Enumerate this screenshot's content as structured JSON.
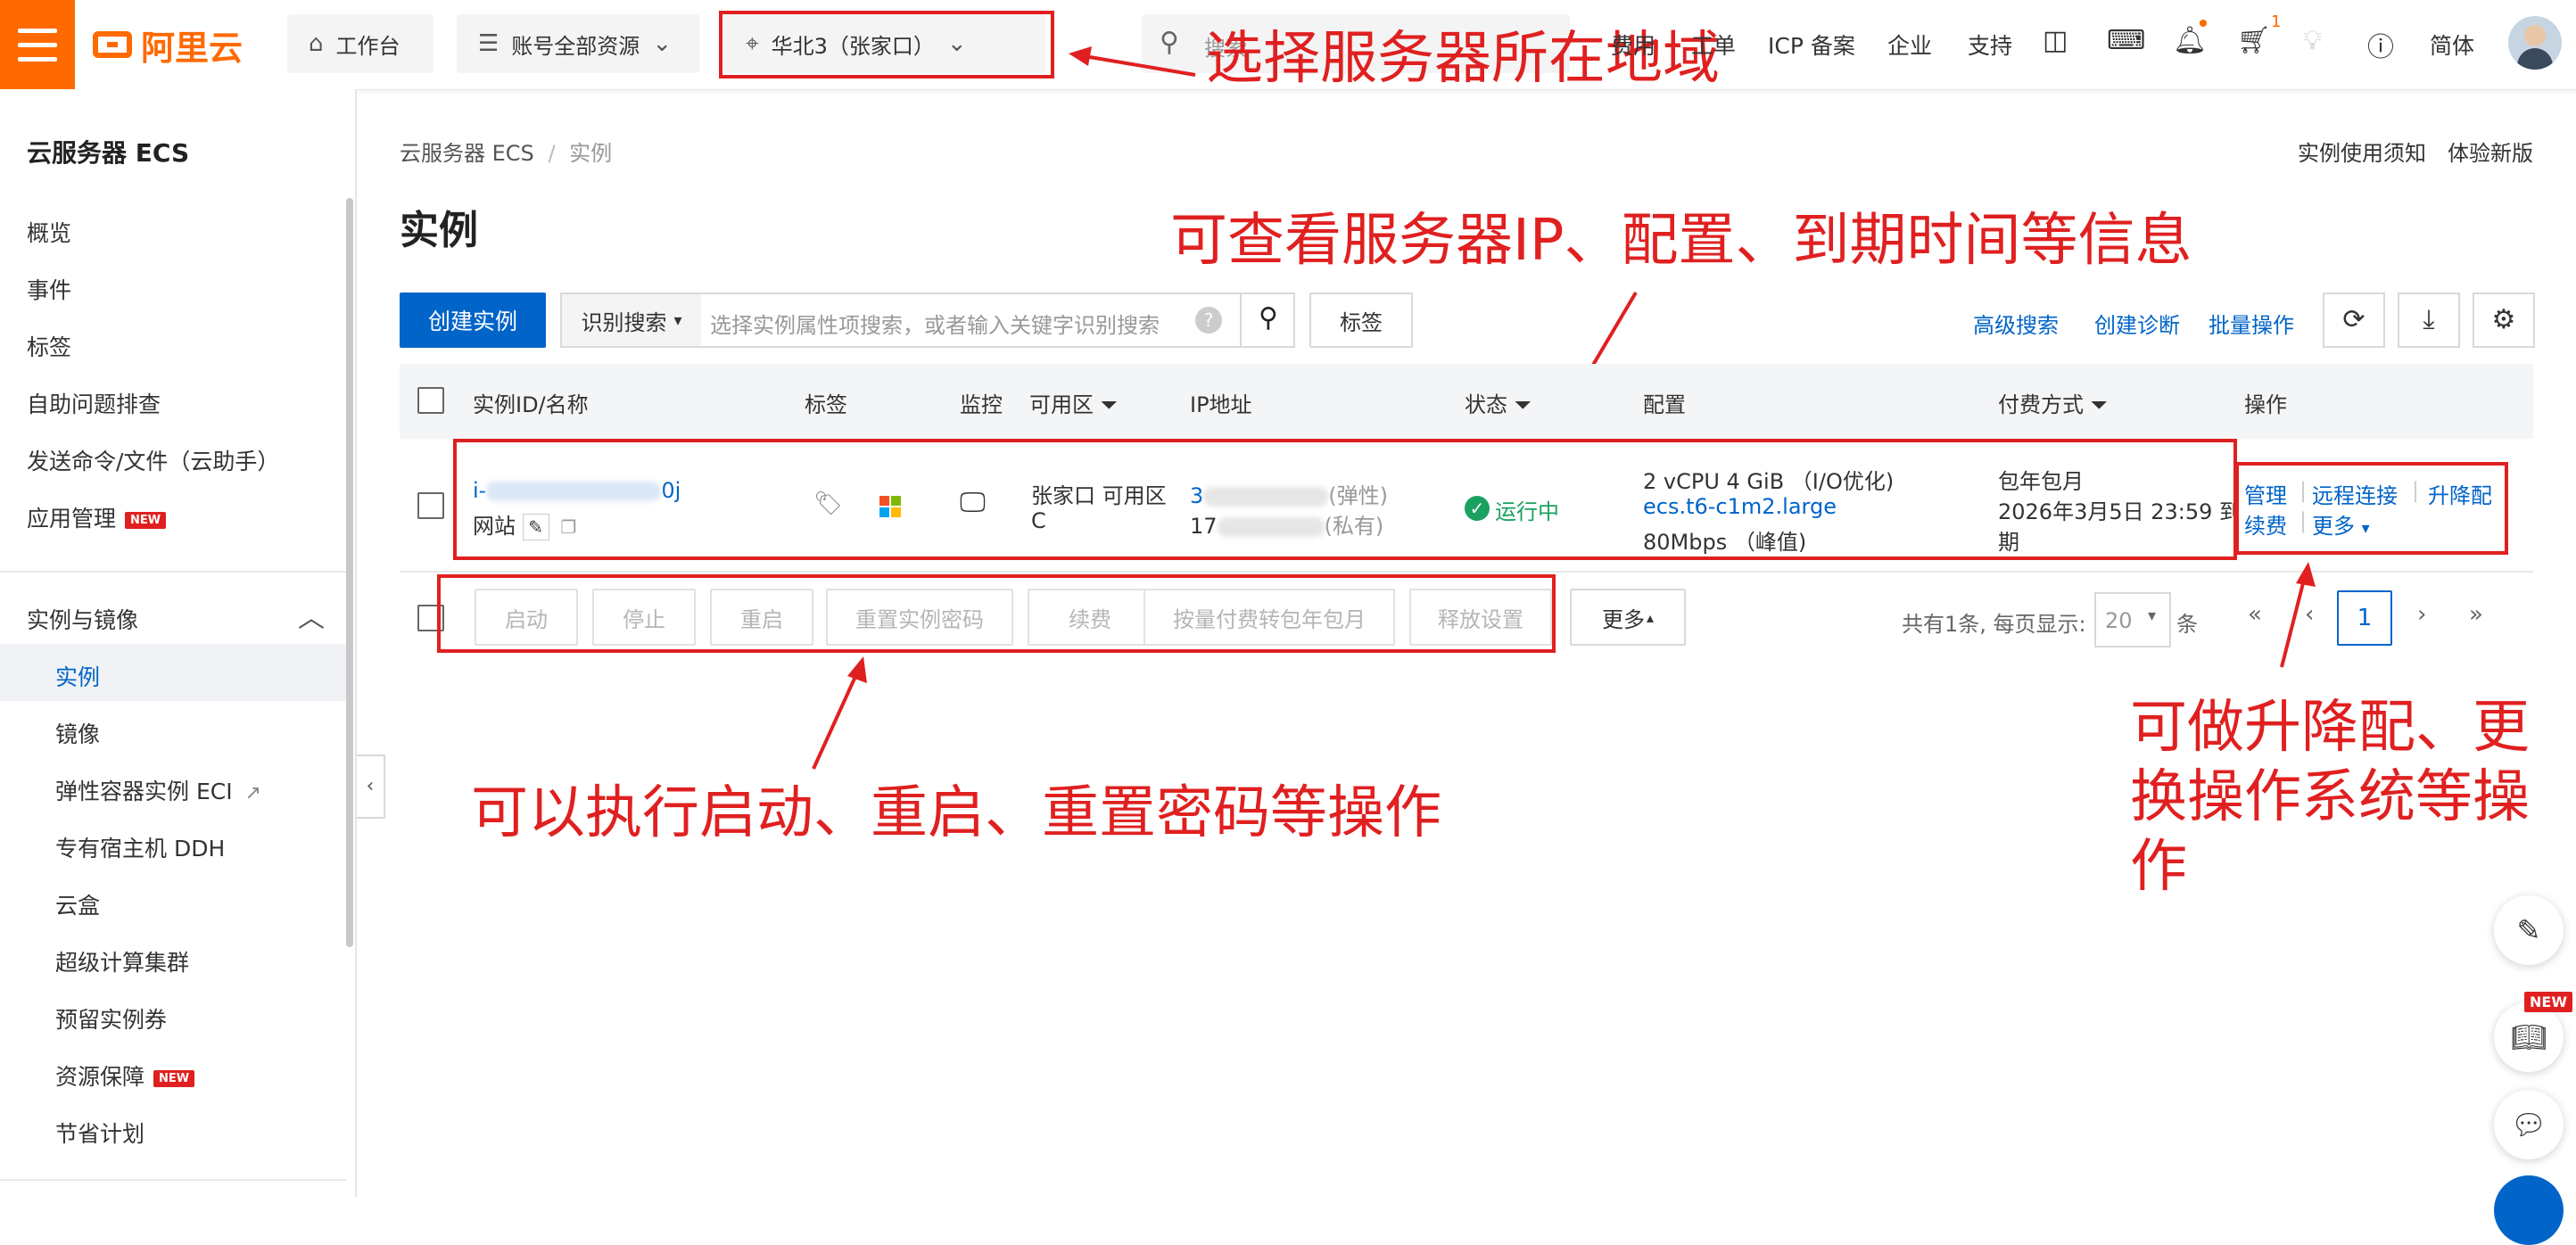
{
  "topbar": {
    "logo": "阿里云",
    "workbench": "工作台",
    "resource_group": "账号全部资源",
    "region": "华北3（张家口）",
    "search_placeholder": "搜索",
    "links": [
      "费用",
      "工单",
      "ICP 备案",
      "企业",
      "支持"
    ],
    "cart_badge": "1",
    "language": "简体"
  },
  "sidebar": {
    "title": "云服务器 ECS",
    "items": [
      "概览",
      "事件",
      "标签",
      "自助问题排查",
      "发送命令/文件（云助手）",
      "应用管理"
    ],
    "app_new_badge": "NEW",
    "group_title": "实例与镜像",
    "sub_items": [
      "实例",
      "镜像",
      "弹性容器实例 ECI",
      "专有宿主机 DDH",
      "云盒",
      "超级计算集群",
      "预留实例券",
      "资源保障",
      "节省计划"
    ],
    "resource_new_badge": "NEW"
  },
  "main": {
    "breadcrumb": [
      "云服务器 ECS",
      "/",
      "实例"
    ],
    "top_links": [
      "实例使用须知",
      "体验新版"
    ],
    "title": "实例",
    "create_button": "创建实例",
    "search_select": "识别搜索",
    "search_placeholder": "选择实例属性项搜索，或者输入关键字识别搜索",
    "tag_button": "标签",
    "actions": [
      "高级搜索",
      "创建诊断",
      "批量操作"
    ],
    "columns": [
      "实例ID/名称",
      "标签",
      "监控",
      "可用区",
      "IP地址",
      "状态",
      "配置",
      "付费方式",
      "操作"
    ],
    "row": {
      "id_prefix": "i-",
      "id_suffix": "0j",
      "name": "网站",
      "zone_line1": "张家口 可用区",
      "zone_line2": "C",
      "ip_public_prefix": "3",
      "ip_public_tag": "(弹性)",
      "ip_private_prefix": "17",
      "ip_private_tag": "(私有)",
      "status": "运行中",
      "config_line1": "2 vCPU 4 GiB （I/O优化)",
      "config_line2": "ecs.t6-c1m2.large",
      "config_line3": "80Mbps （峰值)",
      "billing_line1": "包年包月",
      "billing_line2": "2026年3月5日 23:59 到",
      "billing_line3": "期",
      "op_manage": "管理",
      "op_remote": "远程连接",
      "op_upgrade": "升降配",
      "op_renew": "续费",
      "op_more": "更多"
    },
    "bulk_buttons": [
      "启动",
      "停止",
      "重启",
      "重置实例密码",
      "续费",
      "按量付费转包年包月",
      "释放设置"
    ],
    "bulk_more": "更多",
    "pagination": {
      "summary": "共有1条, 每页显示:",
      "page_size": "20",
      "unit": "条",
      "current_page": "1"
    }
  },
  "annotations": {
    "region": "选择服务器所在地域",
    "info": "可查看服务器IP、配置、到期时间等信息",
    "ops": "可以执行启动、重启、重置密码等操作",
    "upgrade_line1": "可做升降配、更",
    "upgrade_line2": "换操作系统等操",
    "upgrade_line3": "作"
  },
  "float": {
    "new_badge": "NEW"
  },
  "colors": {
    "brand": "#ff6a00",
    "primary": "#0064c8",
    "annotation": "#e02020",
    "success": "#1aa15f"
  }
}
